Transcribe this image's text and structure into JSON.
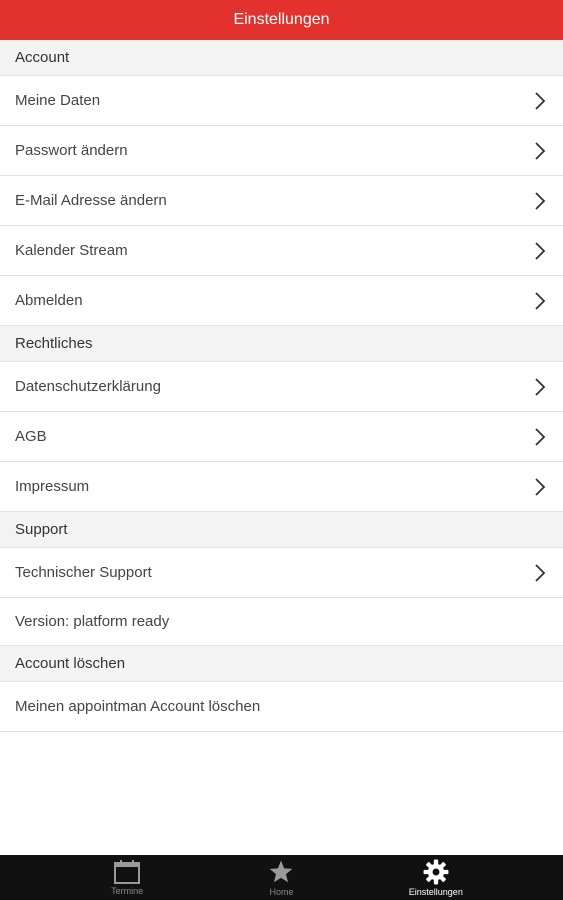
{
  "header": {
    "title": "Einstellungen"
  },
  "sections": [
    {
      "title": "Account",
      "items": [
        "Meine Daten",
        "Passwort ändern",
        "E-Mail Adresse ändern",
        "Kalender Stream",
        "Abmelden"
      ]
    },
    {
      "title": "Rechtliches",
      "items": [
        "Datenschutzerklärung",
        "AGB",
        "Impressum"
      ]
    },
    {
      "title": "Support",
      "items": [
        "Technischer Support",
        "Version: platform ready"
      ]
    },
    {
      "title": "Account löschen",
      "items": [
        "Meinen appointman Account löschen"
      ]
    }
  ],
  "tabs": [
    {
      "label": "Termine",
      "icon": "calendar-icon"
    },
    {
      "label": "Home",
      "icon": "star-icon"
    },
    {
      "label": "Einstellungen",
      "icon": "gear-icon",
      "active": true
    }
  ],
  "colors": {
    "accent": "#e3322e",
    "tabbar": "#111111",
    "section_bg": "#f3f3f3"
  }
}
